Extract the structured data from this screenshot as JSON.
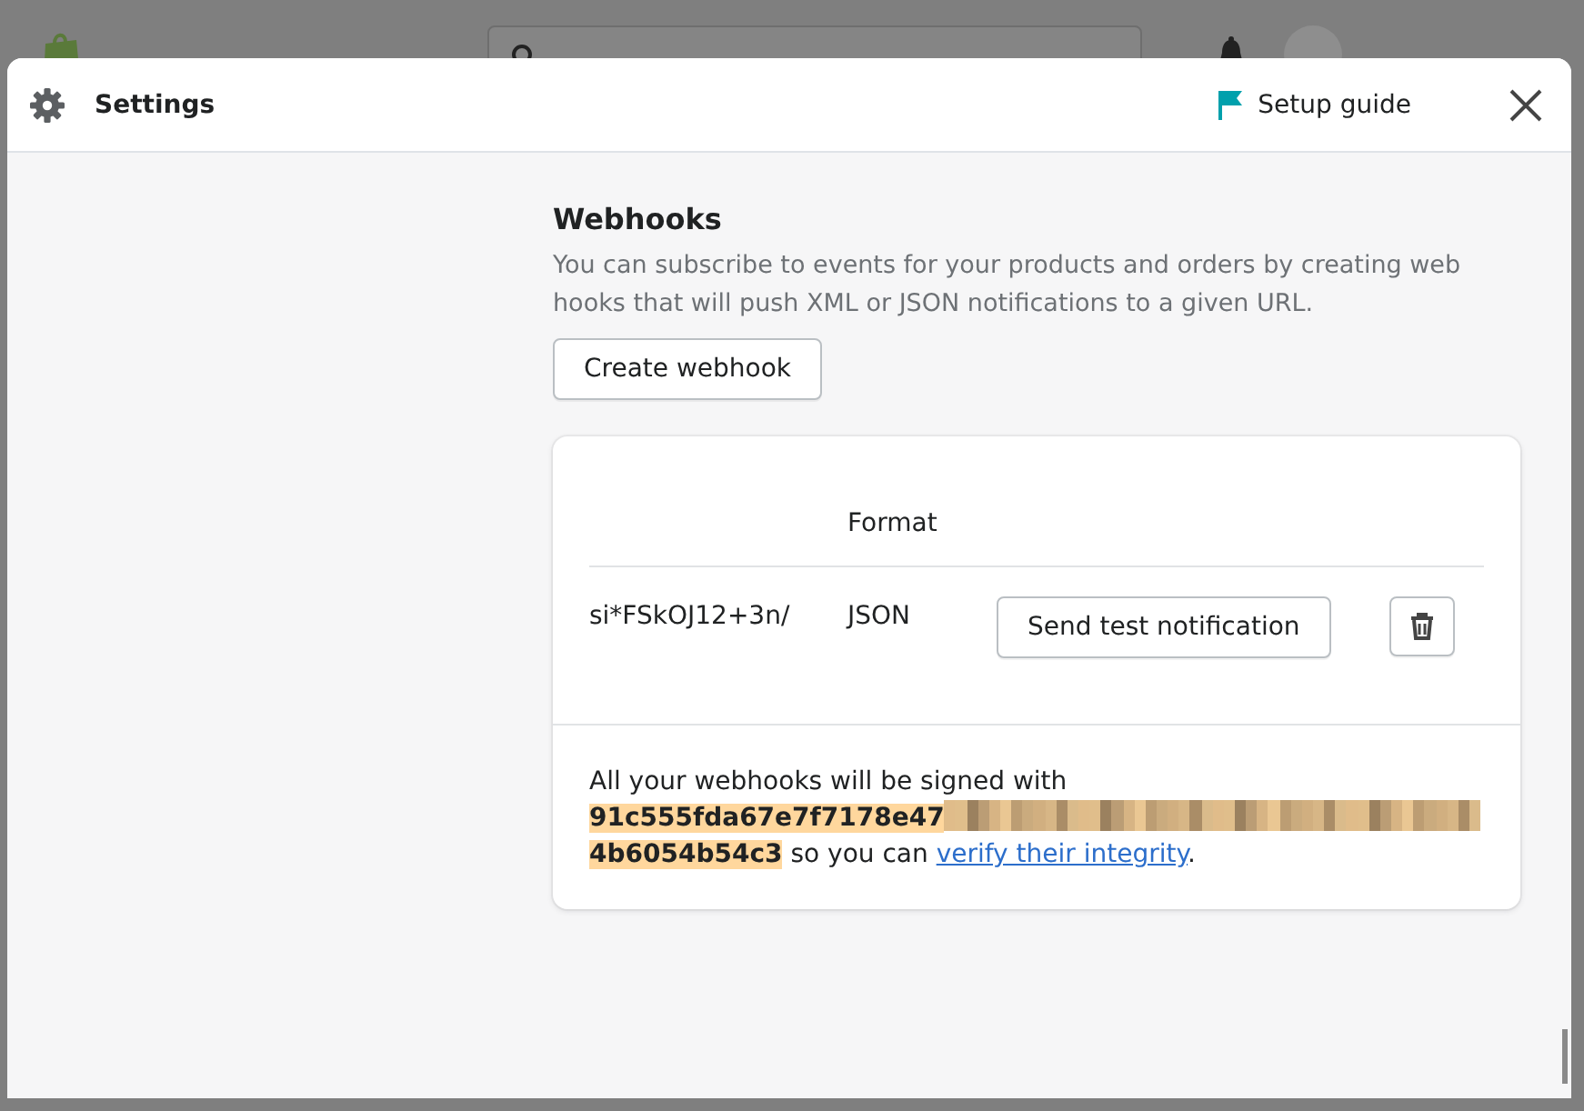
{
  "modal": {
    "title": "Settings",
    "setup_guide": "Setup guide"
  },
  "webhooks": {
    "title": "Webhooks",
    "description": "You can subscribe to events for your products and orders by creating web hooks that will push XML or JSON notifications to a given URL.",
    "create_button": "Create webhook",
    "table": {
      "format_header": "Format",
      "rows": [
        {
          "column_1": "si*FSkOJ12+3n/",
          "format": "JSON",
          "test_button": "Send test notification"
        }
      ]
    },
    "signature": {
      "intro": "All your webhooks will be signed with",
      "key_start": "91c555fda67e7f7178e47",
      "key_end": "4b6054b54c3",
      "middle": "so you can",
      "link": "verify their integrity",
      "end": "."
    }
  }
}
